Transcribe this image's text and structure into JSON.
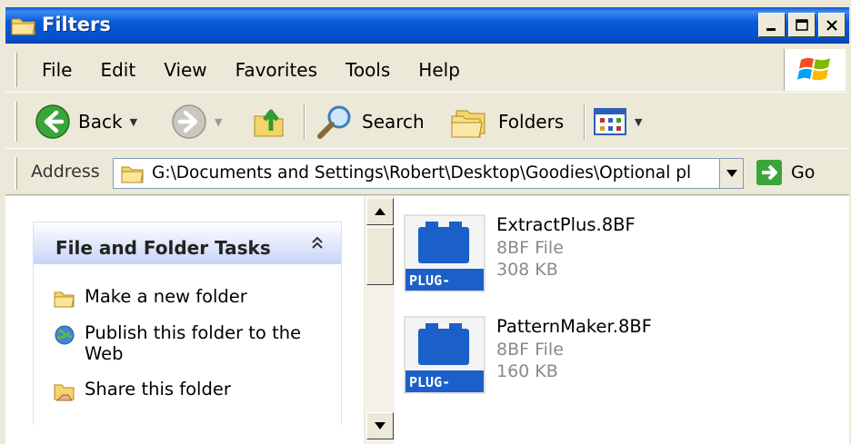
{
  "window": {
    "title": "Filters"
  },
  "menu": [
    "File",
    "Edit",
    "View",
    "Favorites",
    "Tools",
    "Help"
  ],
  "toolbar": {
    "back_label": "Back",
    "search_label": "Search",
    "folders_label": "Folders"
  },
  "address": {
    "label": "Address",
    "value": "G:\\Documents and Settings\\Robert\\Desktop\\Goodies\\Optional pl",
    "go_label": "Go"
  },
  "tasks": {
    "title": "File and Folder Tasks",
    "collapse_glyph": "⌃",
    "items": [
      {
        "label": "Make a new folder",
        "icon": "new-folder-icon"
      },
      {
        "label": "Publish this folder to the Web",
        "icon": "publish-web-icon"
      },
      {
        "label": "Share this folder",
        "icon": "share-folder-icon"
      }
    ]
  },
  "files": [
    {
      "name": "ExtractPlus.8BF",
      "type": "8BF File",
      "size": "308 KB",
      "badge": "PLUG-IN"
    },
    {
      "name": "PatternMaker.8BF",
      "type": "8BF File",
      "size": "160 KB",
      "badge": "PLUG-IN"
    }
  ],
  "colors": {
    "titlebar": "#0A5AD8",
    "chrome": "#ECE9D8",
    "plugin_badge": "#1A60C8"
  }
}
